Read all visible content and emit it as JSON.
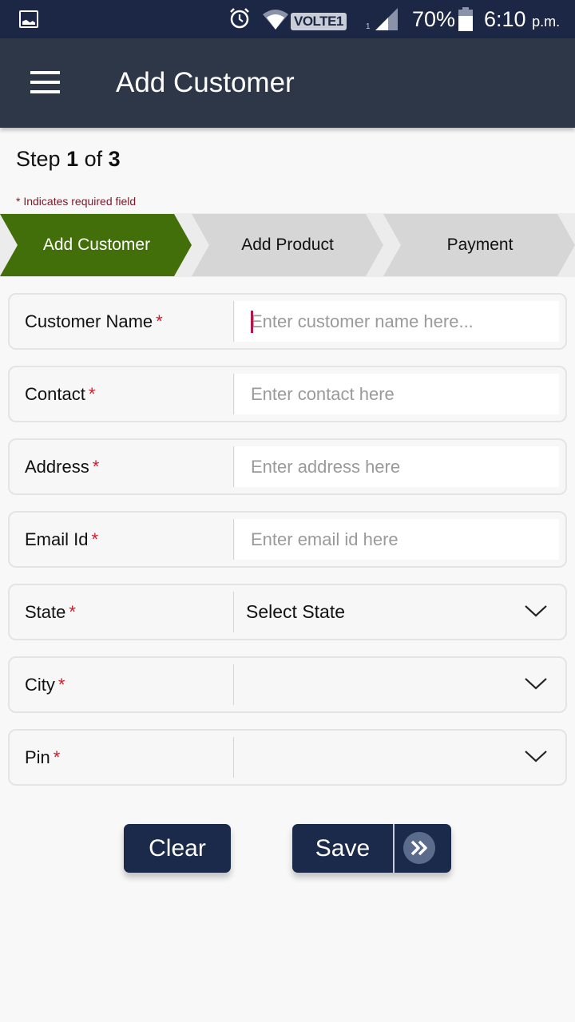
{
  "status_bar": {
    "network_label": "VOLTE1",
    "sim_index": "1",
    "battery_percent": "70%",
    "time": "6:10",
    "time_suffix": "p.m.",
    "icons": [
      "gallery-icon",
      "alarm-icon",
      "wifi-icon",
      "volte-icon",
      "signal-icon",
      "battery-icon"
    ]
  },
  "app_bar": {
    "menu_icon": "hamburger-menu-icon",
    "title": "Add Customer"
  },
  "step": {
    "prefix": "Step",
    "current": "1",
    "middle": "of",
    "total": "3"
  },
  "required_note": "* Indicates required field",
  "stepper": [
    {
      "label": "Add Customer",
      "active": true
    },
    {
      "label": "Add Product",
      "active": false
    },
    {
      "label": "Payment",
      "active": false
    }
  ],
  "form": {
    "required_marker": "*",
    "fields": [
      {
        "label": "Customer Name",
        "type": "text",
        "value": "",
        "placeholder": "Enter customer name here...",
        "focused": true
      },
      {
        "label": "Contact",
        "type": "text",
        "value": "",
        "placeholder": "Enter contact here"
      },
      {
        "label": "Address",
        "type": "text",
        "value": "",
        "placeholder": "Enter address here"
      },
      {
        "label": "Email Id",
        "type": "text",
        "value": "",
        "placeholder": "Enter email id here"
      },
      {
        "label": "State",
        "type": "select",
        "value": "Select State"
      },
      {
        "label": "City",
        "type": "select",
        "value": ""
      },
      {
        "label": "Pin",
        "type": "select",
        "value": ""
      }
    ]
  },
  "buttons": {
    "clear_label": "Clear",
    "save_label": "Save",
    "next_icon": "double-chevron-right-icon"
  },
  "colors": {
    "status_bar": "#1b2744",
    "app_bar": "#2d3748",
    "active_step": "#436f0a",
    "inactive_step": "#d6d6d6",
    "required_asterisk": "#d01a2a",
    "button": "#1b2a4a"
  }
}
